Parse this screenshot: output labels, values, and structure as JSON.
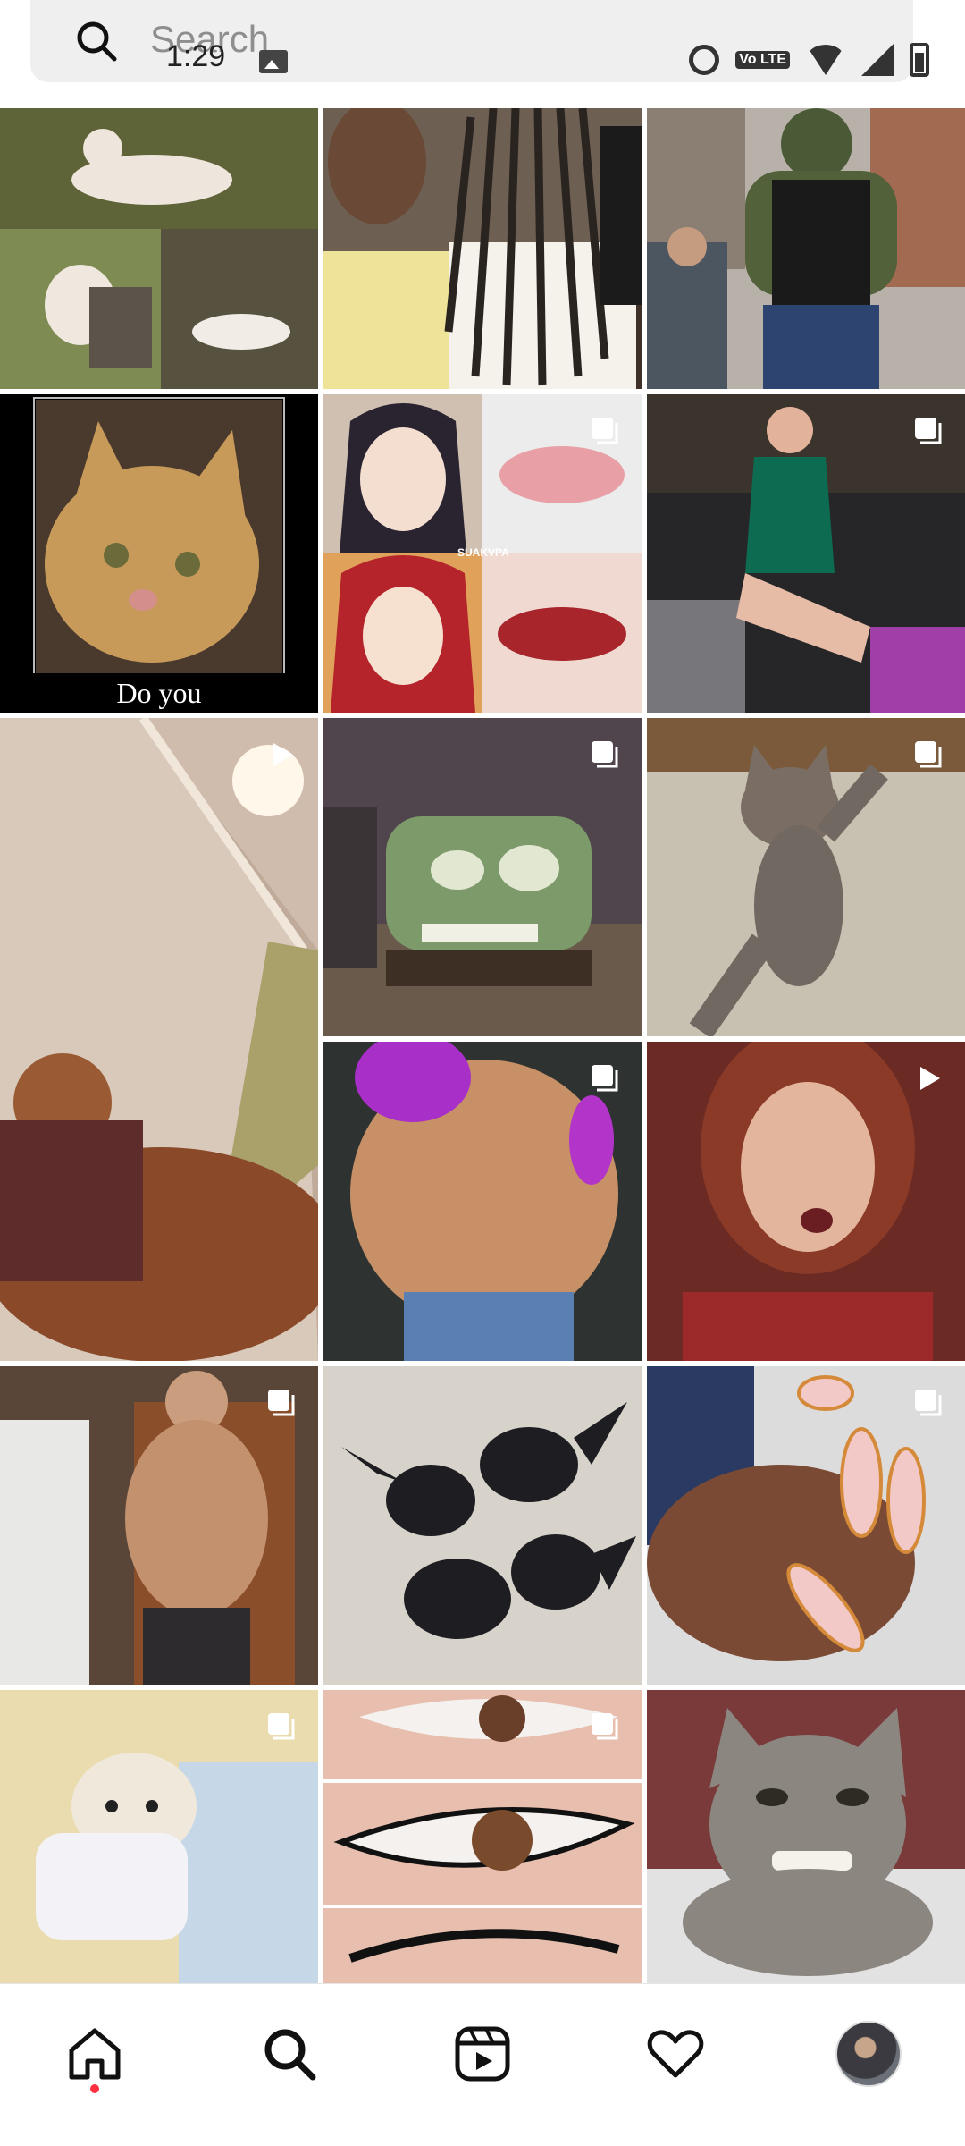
{
  "status_bar": {
    "time": "1:29",
    "volte_label": "Vo LTE"
  },
  "search": {
    "placeholder": "Search"
  },
  "grid": {
    "tiles": [
      {
        "name": "dogs-in-ribbons",
        "badge": "none"
      },
      {
        "name": "braids-selfie",
        "badge": "none"
      },
      {
        "name": "hulk-cosplay",
        "badge": "none"
      },
      {
        "name": "cat-meme-poster",
        "badge": "none",
        "caption": "Do you"
      },
      {
        "name": "anime-lips-collage",
        "badge": "carousel",
        "caption": "SUAKVPA"
      },
      {
        "name": "green-dress-bar",
        "badge": "carousel"
      },
      {
        "name": "cat-ceiling-video",
        "badge": "reel"
      },
      {
        "name": "cars-character",
        "badge": "carousel"
      },
      {
        "name": "dancing-kitten",
        "badge": "carousel"
      },
      {
        "name": "muscle-torso",
        "badge": "carousel"
      },
      {
        "name": "surprised-woman",
        "badge": "reel"
      },
      {
        "name": "shirtless-man",
        "badge": "carousel"
      },
      {
        "name": "bat-kittens",
        "badge": "none"
      },
      {
        "name": "nail-art",
        "badge": "carousel"
      },
      {
        "name": "puppy-in-bed",
        "badge": "carousel"
      },
      {
        "name": "eyeliner-collage",
        "badge": "carousel"
      },
      {
        "name": "grinning-cat",
        "badge": "none"
      }
    ]
  },
  "nav": {
    "items": [
      {
        "icon": "home-icon"
      },
      {
        "icon": "search-icon"
      },
      {
        "icon": "reels-icon"
      },
      {
        "icon": "heart-icon"
      },
      {
        "icon": "profile-avatar"
      }
    ]
  }
}
